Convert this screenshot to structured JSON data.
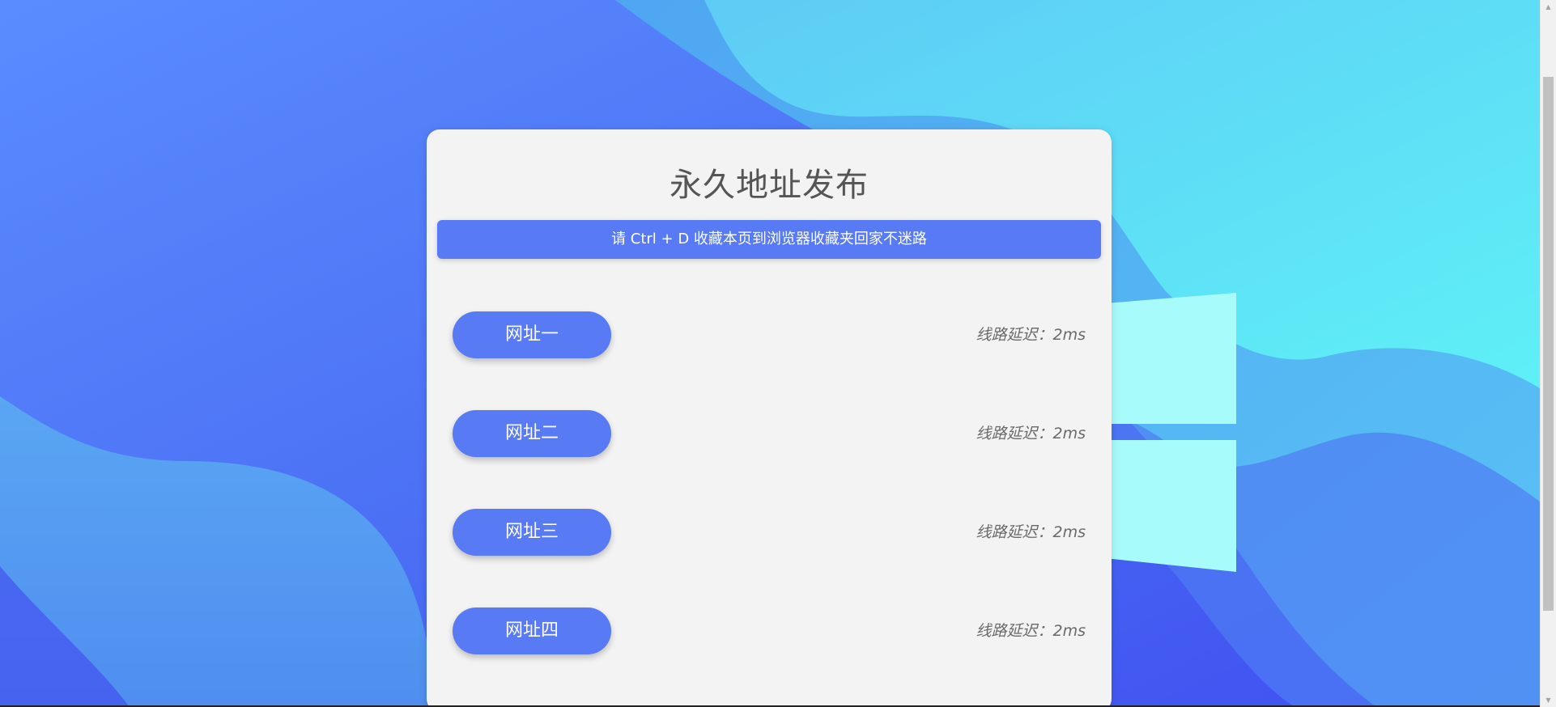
{
  "page": {
    "title": "永久地址发布",
    "banner": "请 Ctrl + D 收藏本页到浏览器收藏夹回家不迷路"
  },
  "links": [
    {
      "label": "网址一",
      "latency": "线路延迟：2ms"
    },
    {
      "label": "网址二",
      "latency": "线路延迟：2ms"
    },
    {
      "label": "网址三",
      "latency": "线路延迟：2ms"
    },
    {
      "label": "网址四",
      "latency": "线路延迟：2ms"
    }
  ],
  "colors": {
    "accent": "#587af4",
    "card": "#f3f3f3",
    "bg_blue": "#4f6ff5",
    "bg_cyan": "#5ee6f7"
  },
  "icons": {
    "background_logo": "windows-logo-icon"
  }
}
